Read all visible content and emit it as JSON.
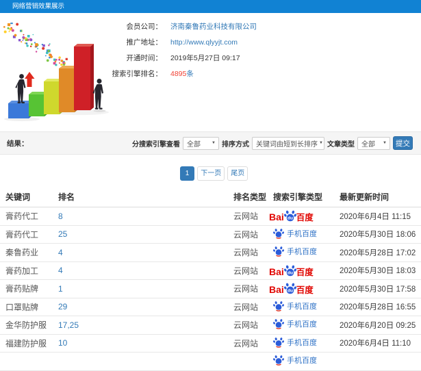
{
  "header": {
    "title": "网络营销效果展示"
  },
  "info": {
    "rows": [
      {
        "label": "会员公司：",
        "value": "济南秦鲁药业科技有限公司"
      },
      {
        "label": "推广地址：",
        "value": "http://www.qlyyjt.com"
      },
      {
        "label": "开通时间：",
        "value": "2019年5月27日 09:17"
      },
      {
        "label": "搜索引擎排名：",
        "value": "4895",
        "suffix": "条"
      }
    ]
  },
  "filter": {
    "result_label": "结果：",
    "engine_label": "分搜索引擎查看",
    "engine_value": "全部",
    "sort_label": "排序方式",
    "sort_value": "关键词由短到长排序",
    "article_label": "文章类型",
    "article_value": "全部",
    "submit_label": "提交"
  },
  "pagination": {
    "current": "1",
    "next": "下一页",
    "last": "尾页"
  },
  "table": {
    "headers": [
      "关键词",
      "排名",
      "排名类型",
      "搜索引擎类型",
      "最新更新时间"
    ],
    "engine_labels": {
      "baidu_bai": "Bai",
      "baidu_du": "du",
      "baidu_cn": "百度",
      "mobile": "手机百度"
    },
    "rows": [
      {
        "keyword": "膏药代工",
        "rank": "8",
        "rank_type": "云网站",
        "engine": "baidu",
        "date": "2020年6月4日 11:15"
      },
      {
        "keyword": "膏药代工",
        "rank": "25",
        "rank_type": "云网站",
        "engine": "mobile",
        "date": "2020年5月30日 18:06"
      },
      {
        "keyword": "秦鲁药业",
        "rank": "4",
        "rank_type": "云网站",
        "engine": "mobile",
        "date": "2020年5月28日 17:02"
      },
      {
        "keyword": "膏药加工",
        "rank": "4",
        "rank_type": "云网站",
        "engine": "baidu",
        "date": "2020年5月30日 18:03"
      },
      {
        "keyword": "膏药贴牌",
        "rank": "1",
        "rank_type": "云网站",
        "engine": "baidu",
        "date": "2020年5月30日 17:58"
      },
      {
        "keyword": "口罩贴牌",
        "rank": "29",
        "rank_type": "云网站",
        "engine": "mobile",
        "date": "2020年5月28日 16:55"
      },
      {
        "keyword": "金华防护服",
        "rank": "17,25",
        "rank_type": "云网站",
        "engine": "mobile",
        "date": "2020年6月20日 09:25"
      },
      {
        "keyword": "福建防护服",
        "rank": "10",
        "rank_type": "云网站",
        "engine": "mobile",
        "date": "2020年6月4日 11:10"
      },
      {
        "keyword": "",
        "rank": "",
        "rank_type": "",
        "engine": "mobile",
        "date": ""
      }
    ]
  },
  "colors": {
    "topbar": "#1182d3",
    "link": "#337ab7",
    "count": "#f04134",
    "baidu_red": "#e10601",
    "paw_blue": "#2b5cd9"
  }
}
